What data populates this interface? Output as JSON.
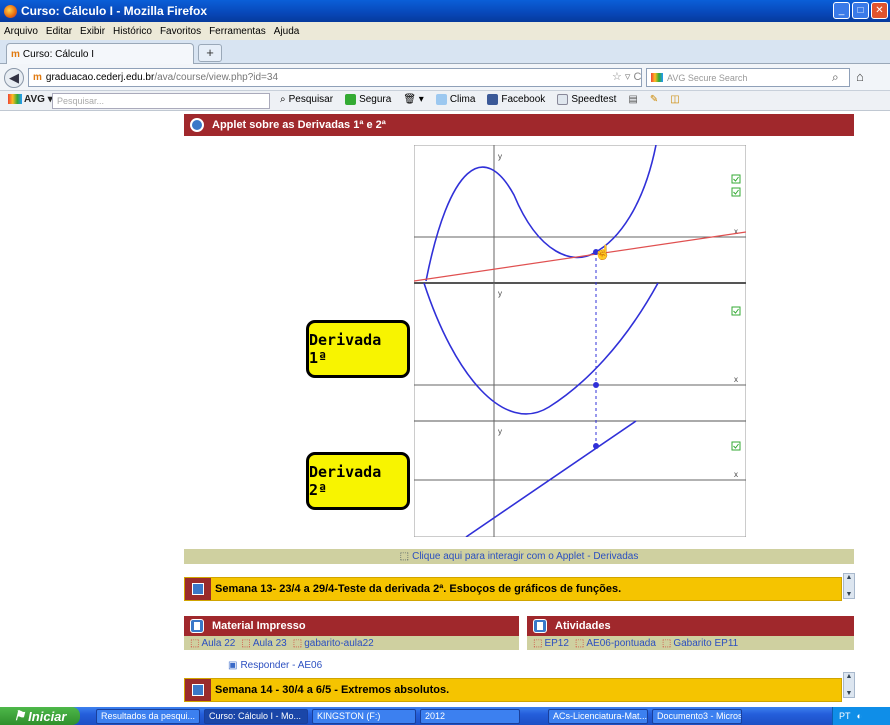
{
  "window": {
    "title": "Curso: Cálculo I - Mozilla Firefox"
  },
  "menu": [
    "Arquivo",
    "Editar",
    "Exibir",
    "Histórico",
    "Favoritos",
    "Ferramentas",
    "Ajuda"
  ],
  "tab": {
    "title": "Curso: Cálculo I",
    "new_tab": "+"
  },
  "nav": {
    "url_host": "graduacao.cederj.edu.br",
    "url_path": "/ava/course/view.php?id=34",
    "search_placeholder": "AVG Secure Search"
  },
  "avg": {
    "logo": "AVG",
    "search_placeholder": "Pesquisar...",
    "items": [
      "Pesquisar",
      "Segura",
      "Clima",
      "Facebook",
      "Speedtest"
    ]
  },
  "applet": {
    "header": "Applet sobre as Derivadas 1ª e 2ª",
    "label1": "Derivada 1ª",
    "label2": "Derivada 2ª",
    "axis_y": "y",
    "axis_x": "x",
    "link": "Clique aqui para interagir com o Applet - Derivadas"
  },
  "week13": {
    "title": "Semana 13- 23/4 a 29/4-Teste da derivada 2ª. Esboços de gráficos de funções."
  },
  "material": {
    "header": "Material Impresso",
    "links": [
      "Aula 22",
      "Aula 23",
      "gabarito-aula22"
    ]
  },
  "atividades": {
    "header": "Atividades",
    "links": [
      "EP12",
      "AE06-pontuada",
      "Gabarito EP11"
    ]
  },
  "responder": "Responder - AE06",
  "week14": {
    "title": "Semana 14 - 30/4 a 6/5 - Extremos absolutos."
  },
  "taskbar": {
    "start": "Iniciar",
    "items": [
      "Resultados da pesqui...",
      "Curso: Cálculo I - Mo...",
      "KINGSTON (F:)",
      "2012",
      "ACs-Licenciatura-Mat...",
      "Documento3 - Micros..."
    ],
    "lang": "PT"
  },
  "colors": {
    "header_red": "#a0282c",
    "week_yellow": "#f5c400",
    "curve_blue": "#3030d8",
    "tangent_red": "#e05050"
  }
}
